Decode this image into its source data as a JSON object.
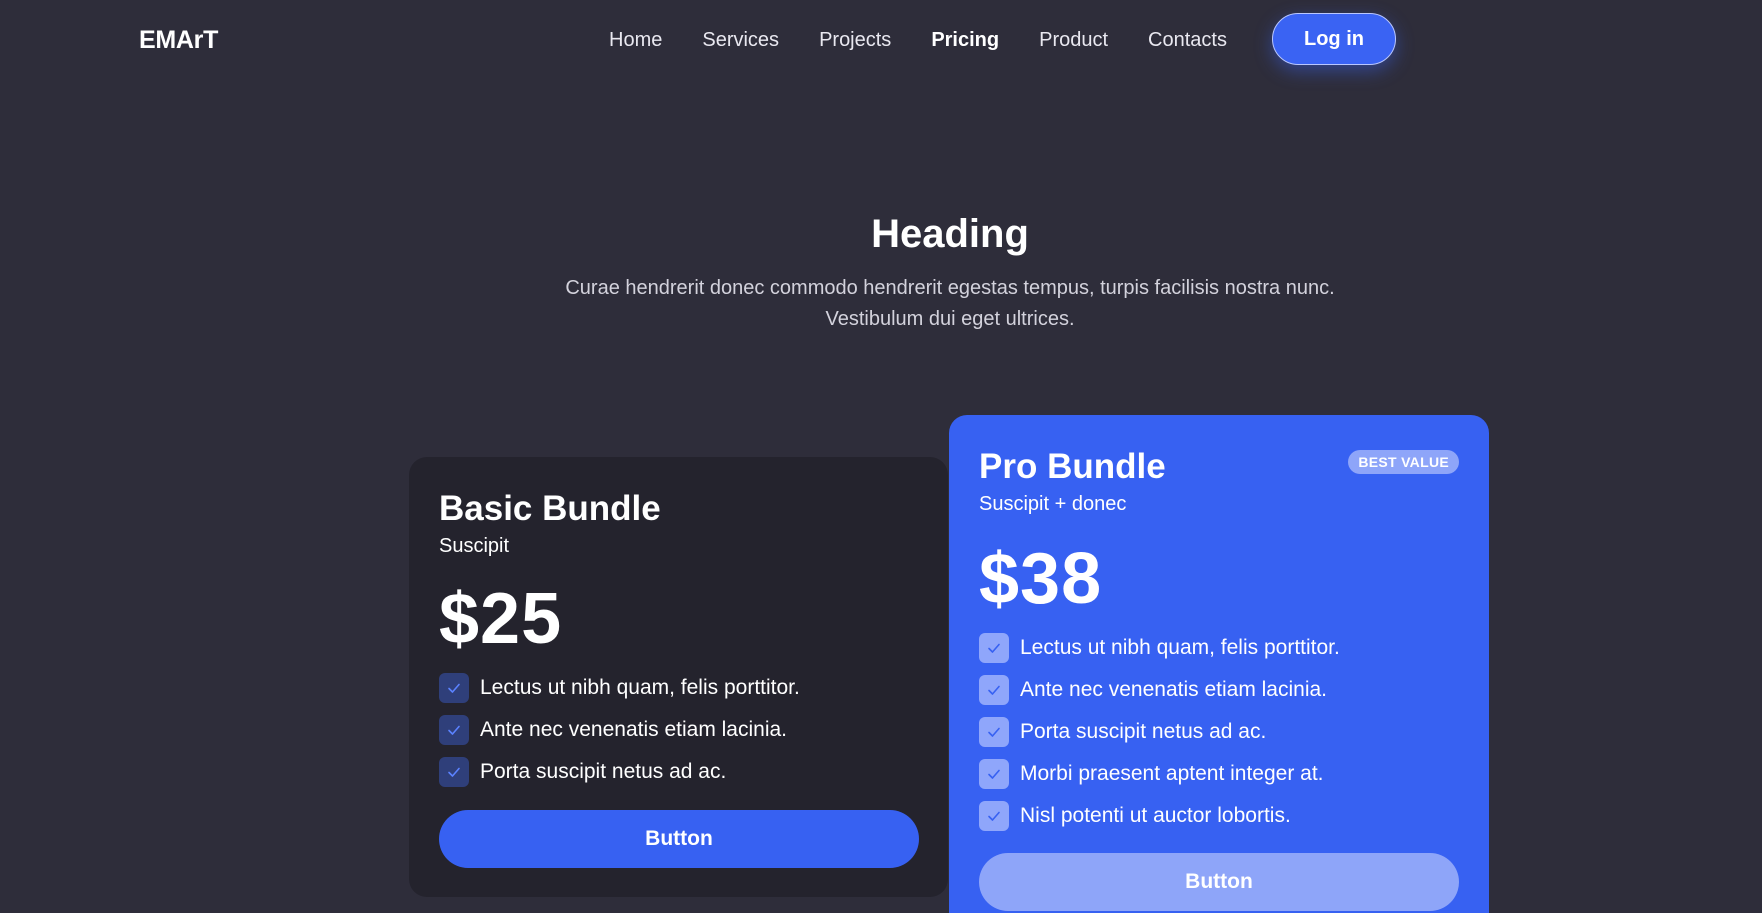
{
  "header": {
    "brand": "EMArT",
    "nav": [
      {
        "label": "Home",
        "active": false
      },
      {
        "label": "Services",
        "active": false
      },
      {
        "label": "Projects",
        "active": false
      },
      {
        "label": "Pricing",
        "active": true
      },
      {
        "label": "Product",
        "active": false
      },
      {
        "label": "Contacts",
        "active": false
      }
    ],
    "login_label": "Log in"
  },
  "hero": {
    "heading": "Heading",
    "subtext": "Curae hendrerit donec commodo hendrerit egestas tempus, turpis facilisis nostra nunc. Vestibulum dui eget ultrices."
  },
  "plans": {
    "basic": {
      "title": "Basic Bundle",
      "subtitle": "Suscipit",
      "price": "$25",
      "features": [
        "Lectus ut nibh quam, felis porttitor.",
        "Ante nec venenatis etiam lacinia.",
        "Porta suscipit netus ad ac."
      ],
      "button_label": "Button"
    },
    "pro": {
      "title": "Pro Bundle",
      "subtitle": "Suscipit + donec",
      "badge": "BEST VALUE",
      "price": "$38",
      "features": [
        "Lectus ut nibh quam, felis porttitor.",
        "Ante nec venenatis etiam lacinia.",
        "Porta suscipit netus ad ac.",
        "Morbi praesent aptent integer at.",
        "Nisl potenti ut auctor lobortis."
      ],
      "button_label": "Button"
    }
  },
  "colors": {
    "background": "#2e2d3a",
    "accent": "#3761f2",
    "basic_card": "#24232d",
    "pro_button": "#8ea5f9"
  },
  "icons": {
    "feature_check": "check-icon"
  }
}
